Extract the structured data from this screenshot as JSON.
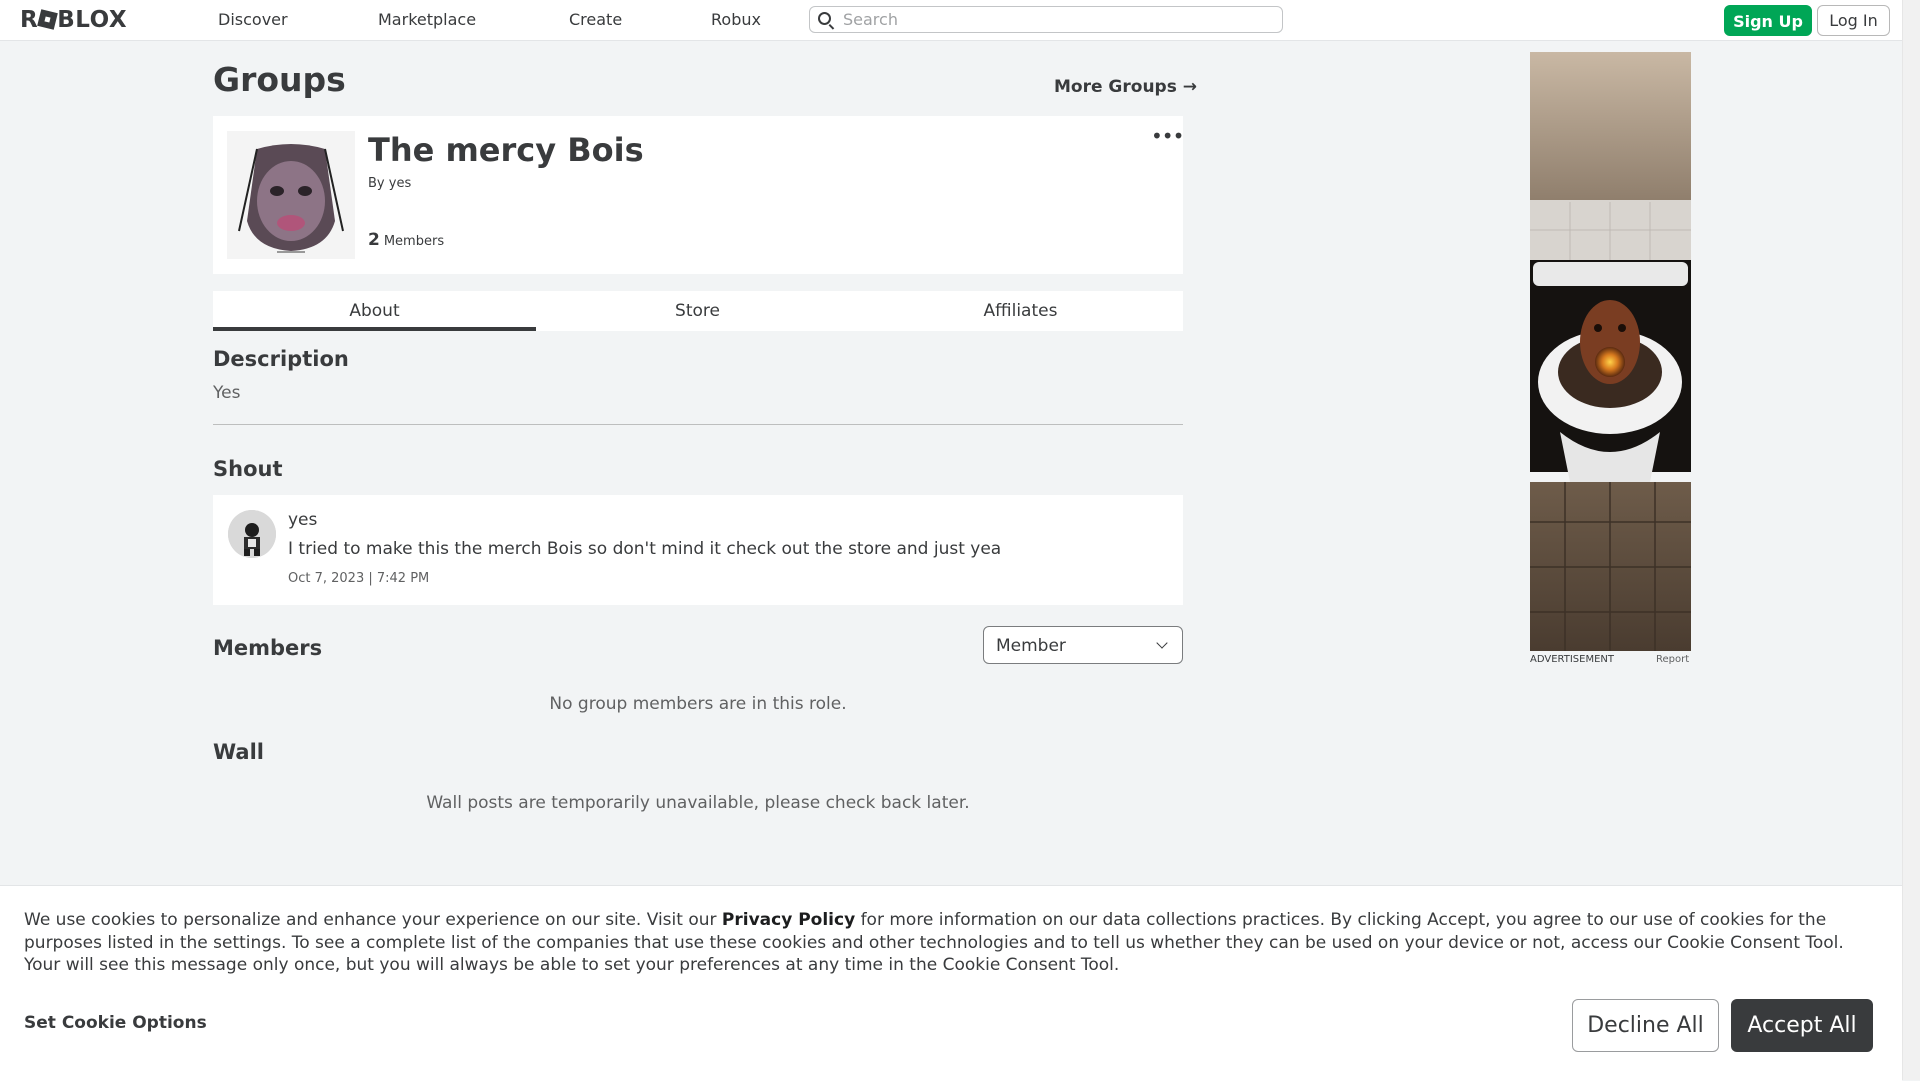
{
  "nav": {
    "logo": "ROBLOX",
    "links": [
      "Discover",
      "Marketplace",
      "Create",
      "Robux"
    ],
    "search_placeholder": "Search",
    "signup": "Sign Up",
    "login": "Log In"
  },
  "page": {
    "title": "Groups",
    "more_groups": "More Groups →"
  },
  "group": {
    "name": "The mercy Bois",
    "by_prefix": "By",
    "owner": "yes",
    "member_count": "2",
    "members_label": "Members",
    "more_icon": "ellipsis-icon"
  },
  "tabs": [
    {
      "label": "About",
      "active": true
    },
    {
      "label": "Store",
      "active": false
    },
    {
      "label": "Affiliates",
      "active": false
    }
  ],
  "description": {
    "title": "Description",
    "text": "Yes"
  },
  "shout": {
    "title": "Shout",
    "user": "yes",
    "text": "I tried to make this the merch Bois so don't mind it check out the store and just yea",
    "date": "Oct 7, 2023 | 7:42 PM"
  },
  "members": {
    "title": "Members",
    "role_selected": "Member",
    "empty_message": "No group members are in this role."
  },
  "wall": {
    "title": "Wall",
    "message": "Wall posts are temporarily unavailable, please check back later."
  },
  "ad": {
    "label": "ADVERTISEMENT",
    "report": "Report"
  },
  "cookie": {
    "text_before": "We use cookies to personalize and enhance your experience on our site. Visit our ",
    "privacy_link": "Privacy Policy",
    "text_after": " for more information on our data collections practices. By clicking Accept, you agree to our use of cookies for the purposes listed in the settings. To see a complete list of the companies that use these cookies and other technologies and to tell us whether they can be used on your device or not, access our Cookie Consent Tool. Your will see this message only once, but you will always be able to set your preferences at any time in the Cookie Consent Tool.",
    "options": "Set Cookie Options",
    "decline": "Decline All",
    "accept": "Accept All"
  },
  "colors": {
    "accent_green": "#00a656",
    "text_dark": "#393b3d",
    "page_bg": "#f2f4f5"
  }
}
